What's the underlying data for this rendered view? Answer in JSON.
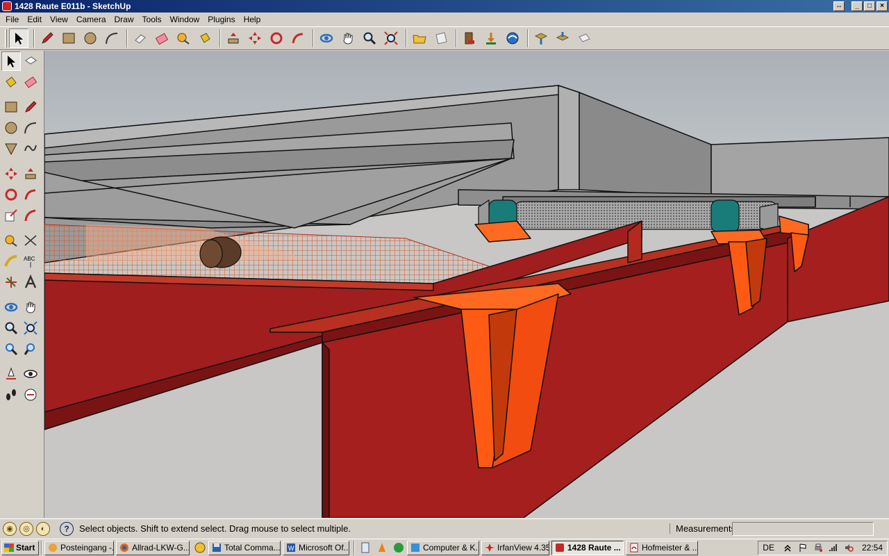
{
  "window": {
    "title": "1428 Raute E011b - SketchUp",
    "restore_glyph": "↔",
    "min_glyph": "_",
    "max_glyph": "□",
    "close_glyph": "×"
  },
  "menu": [
    "File",
    "Edit",
    "View",
    "Camera",
    "Draw",
    "Tools",
    "Window",
    "Plugins",
    "Help"
  ],
  "toolbar_icons": [
    "select-icon",
    "pencil-icon",
    "rectangle-icon",
    "circle-icon",
    "arc-icon",
    "eraser-icon",
    "paint-bucket-icon",
    "tape-measure-icon",
    "paint-icon",
    "push-pull-icon",
    "move-icon",
    "rotate-icon",
    "follow-me-icon",
    "orbit-icon",
    "pan-icon",
    "zoom-icon",
    "zoom-extents-icon",
    "folder-icon",
    "page-icon",
    "components-icon",
    "get-models-icon",
    "share-icon",
    "layer-export-icon",
    "layer-import-icon",
    "print-icon"
  ],
  "palette_labels": {
    "text_tool": "ABC"
  },
  "status": {
    "icons": [
      "geo-icon",
      "credit-icon",
      "user-icon"
    ],
    "help_glyph": "?",
    "message": "Select objects. Shift to extend select. Drag mouse to select multiple.",
    "measurements_label": "Measurements",
    "measurements_value": ""
  },
  "taskbar": {
    "start_label": "Start",
    "tasks": [
      {
        "label": "Posteingang -...",
        "color": "#e8a33a"
      },
      {
        "label": "Allrad-LKW-G...",
        "color": "#e3661a"
      },
      {
        "label": "Total Comma...",
        "color": "#2a5fb0"
      },
      {
        "label": "Microsoft Of...",
        "color": "#2b56a8"
      },
      {
        "label": "Computer & K...",
        "color": "#3a8fd6"
      },
      {
        "label": "IrfanView 4.35",
        "color": "#c42020"
      },
      {
        "label": "1428 Raute ...",
        "color": "#c62828",
        "active": true
      },
      {
        "label": "Hofmeister & ...",
        "color": "#b01a1a"
      }
    ],
    "language": "DE",
    "clock": "22:54"
  },
  "colors": {
    "frame_red": "#a01e1e",
    "bracket_orange": "#ff5a14",
    "body_grey": "#9b9b9b",
    "roller_teal": "#1a7c78",
    "sky": "#c9cac9"
  }
}
